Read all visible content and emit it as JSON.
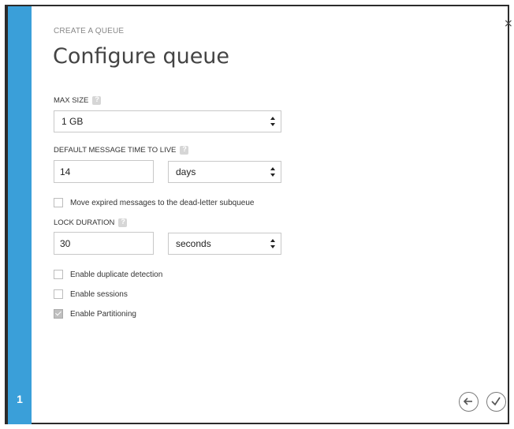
{
  "dialog": {
    "close_glyph": "×",
    "step_number": "1",
    "subtitle": "CREATE A QUEUE",
    "title": "Configure queue"
  },
  "max_size": {
    "label": "MAX SIZE",
    "value": "1 GB"
  },
  "ttl": {
    "label": "DEFAULT MESSAGE TIME TO LIVE",
    "value": "14",
    "unit": "days"
  },
  "dead_letter": {
    "label": "Move expired messages to the dead-letter subqueue",
    "checked": false
  },
  "lock_duration": {
    "label": "LOCK DURATION",
    "value": "30",
    "unit": "seconds"
  },
  "options": [
    {
      "label": "Enable duplicate detection",
      "checked": false
    },
    {
      "label": "Enable sessions",
      "checked": false
    },
    {
      "label": "Enable Partitioning",
      "checked": true
    }
  ],
  "nav": {
    "back_icon": "arrow-left-icon",
    "done_icon": "checkmark-icon"
  },
  "colors": {
    "accent": "#3a9fd9"
  }
}
